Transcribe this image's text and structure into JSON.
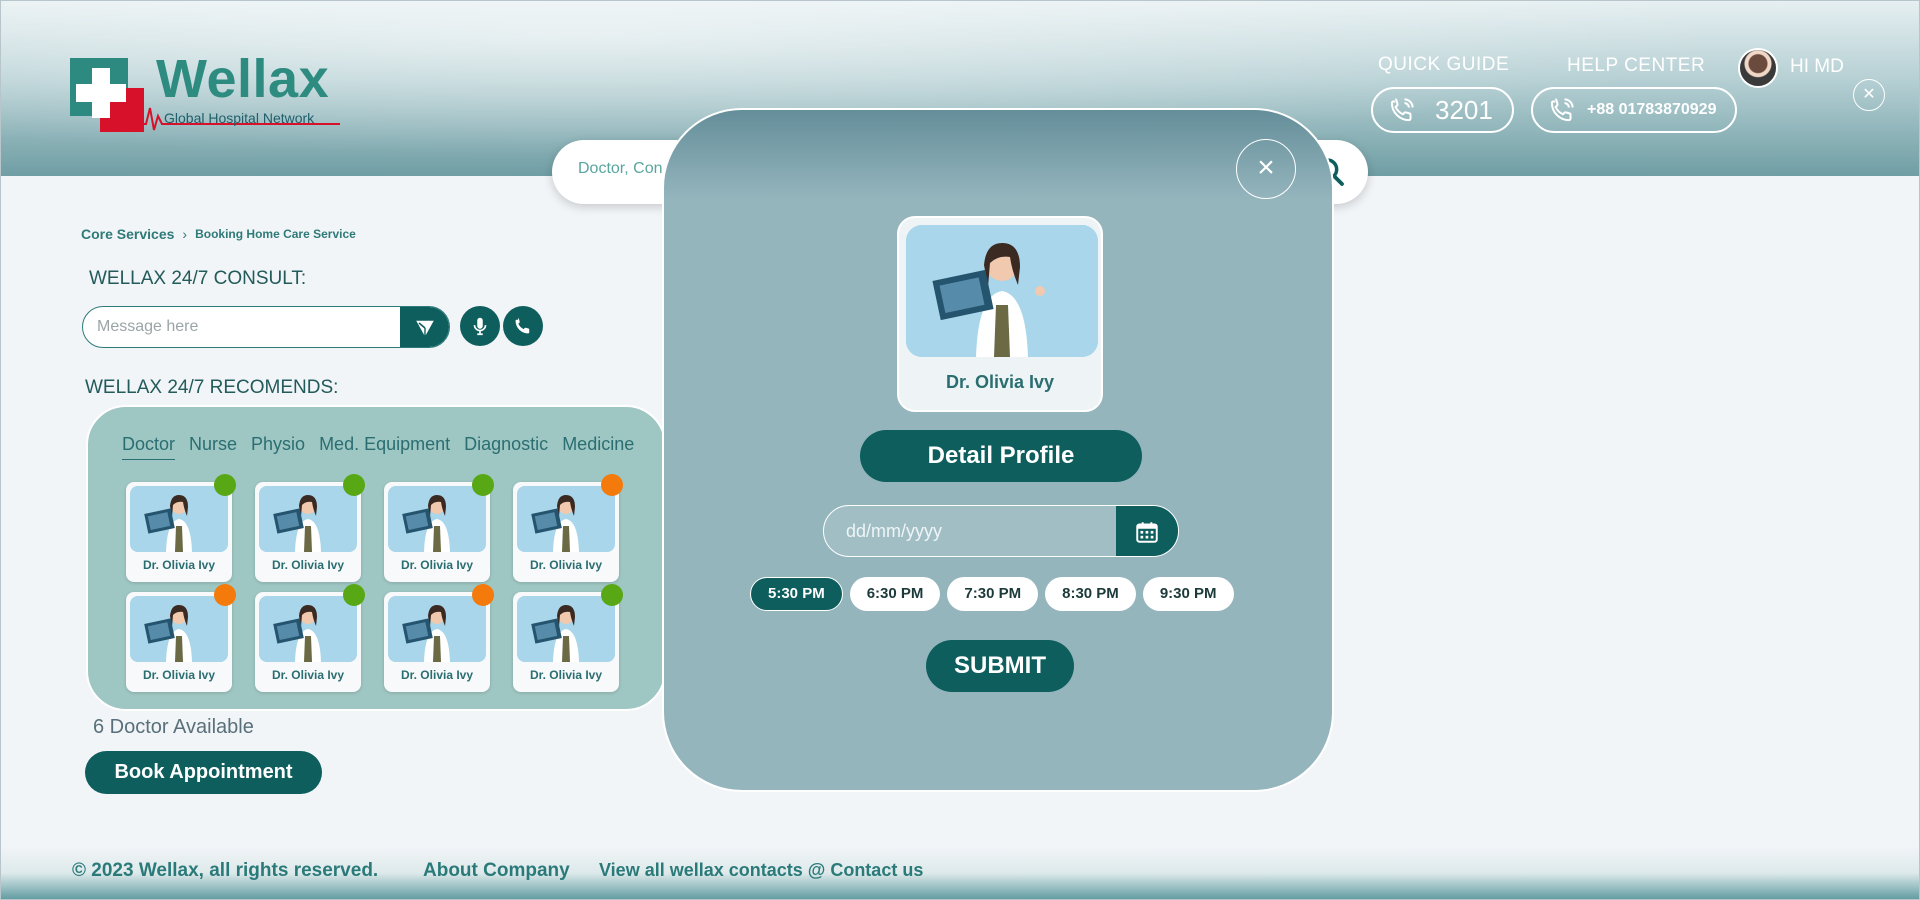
{
  "brand": {
    "name": "Wellax",
    "tagline": "Global Hospital Network",
    "colors": {
      "primary": "#0e5e5e",
      "accent": "#2c8a80",
      "logo_red": "#d7112a",
      "status_green": "#58a715",
      "status_orange": "#f57a0c"
    }
  },
  "header": {
    "quick_guide_label": "QUICK GUIDE",
    "quick_guide_number": "3201",
    "help_center_label": "HELP CENTER",
    "help_center_number": "+88 01783870929",
    "greeting": "HI MD",
    "close_icon": "close-icon"
  },
  "search": {
    "placeholder": "Doctor, Consultant, Specialist...",
    "visible_text": "Doctor, Con",
    "icon": "search-icon"
  },
  "breadcrumb": {
    "items": [
      "Core Services",
      "Booking Home Care Service"
    ]
  },
  "consult": {
    "title": "WELLAX 24/7 CONSULT:",
    "message_placeholder": "Message here",
    "icons": [
      "send-icon",
      "microphone-icon",
      "phone-icon"
    ]
  },
  "recommends": {
    "title": "WELLAX 24/7 RECOMENDS:",
    "tabs": [
      "Doctor",
      "Nurse",
      "Physio",
      "Med. Equipment",
      "Diagnostic",
      "Medicine"
    ],
    "active_tab": "Doctor",
    "doctors": [
      {
        "name": "Dr. Olivia Ivy",
        "status": "green"
      },
      {
        "name": "Dr. Olivia Ivy",
        "status": "green"
      },
      {
        "name": "Dr. Olivia Ivy",
        "status": "green"
      },
      {
        "name": "Dr. Olivia Ivy",
        "status": "orange"
      },
      {
        "name": "Dr. Olivia Ivy",
        "status": "orange"
      },
      {
        "name": "Dr. Olivia Ivy",
        "status": "green"
      },
      {
        "name": "Dr. Olivia Ivy",
        "status": "orange"
      },
      {
        "name": "Dr. Olivia Ivy",
        "status": "green"
      }
    ],
    "available_text": "6 Doctor Available",
    "book_label": "Book Appointment"
  },
  "modal": {
    "doctor_name": "Dr. Olivia Ivy",
    "detail_label": "Detail Profile",
    "date_placeholder": "dd/mm/yyyy",
    "time_slots": [
      "5:30 PM",
      "6:30 PM",
      "7:30 PM",
      "8:30 PM",
      "9:30 PM"
    ],
    "selected_slot": "5:30 PM",
    "submit_label": "SUBMIT"
  },
  "footer": {
    "copyright": "© 2023 Wellax, all rights reserved.",
    "about": "About Company",
    "contacts": "View all wellax contacts @ Contact us"
  }
}
